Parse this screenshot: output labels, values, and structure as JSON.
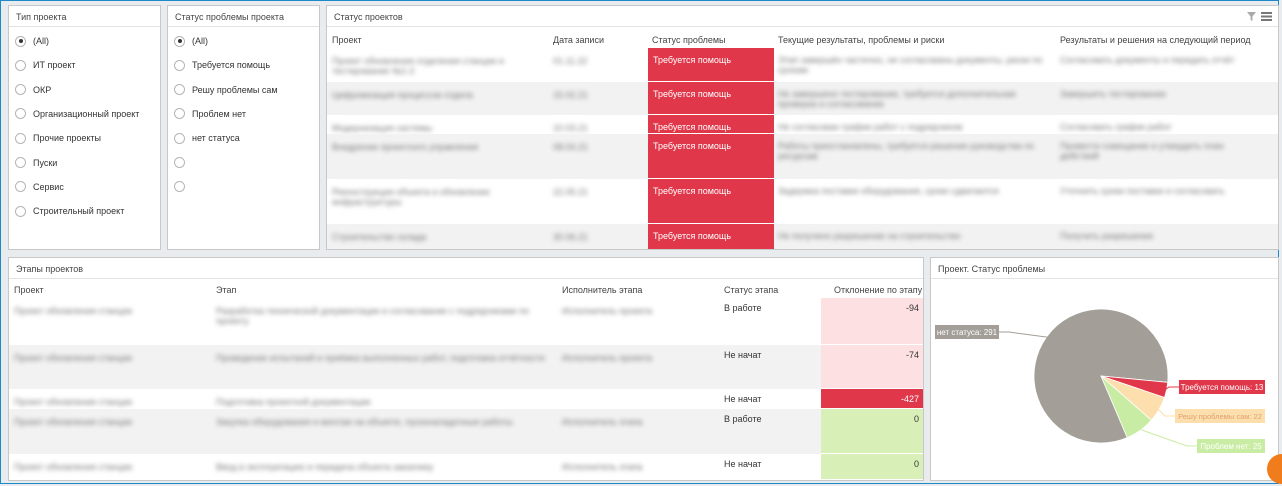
{
  "filter_project_type": {
    "title": "Тип проекта",
    "options": [
      "(All)",
      "ИТ проект",
      "ОКР",
      "Организационный проект",
      "Прочие проекты",
      "Пуски",
      "Сервис",
      "Строительный проект"
    ],
    "selected": "(All)"
  },
  "filter_problem_status": {
    "title": "Статус проблемы проекта",
    "options": [
      "(All)",
      "Требуется помощь",
      "Решу проблемы сам",
      "Проблем нет",
      "нет статуса",
      "",
      ""
    ],
    "selected": "(All)"
  },
  "project_status": {
    "title": "Статус проектов",
    "columns": [
      "Проект",
      "Дата записи",
      "Статус проблемы",
      "Текущие результаты, проблемы и риски",
      "Результаты и решения на следующий период"
    ],
    "rows": [
      {
        "project": "Проект обновления отделения станции и тестирование №1-2",
        "date": "01.11.22",
        "status": "Требуется помощь",
        "current": "Этап завершён частично, не согласованы документы, риски по срокам",
        "next": "Согласовать документы и передать отчёт"
      },
      {
        "project": "Цифровизация процессов отдела",
        "date": "15.02.21",
        "status": "Требуется помощь",
        "current": "Не завершено тестирование, требуется дополнительная проверка и согласование",
        "next": "Завершить тестирование"
      },
      {
        "project": "Модернизация системы",
        "date": "10.03.21",
        "status": "Требуется помощь",
        "current": "Не согласован график работ с подрядчиком",
        "next": "Согласовать график работ"
      },
      {
        "project": "Внедрение проектного управления",
        "date": "08.04.21",
        "status": "Требуется помощь",
        "current": "Работы приостановлены, требуется решение руководства по ресурсам",
        "next": "Провести совещание и утвердить план действий"
      },
      {
        "project": "Реконструкция объекта и обновление инфраструктуры",
        "date": "22.05.21",
        "status": "Требуется помощь",
        "current": "Задержка поставки оборудования, сроки сдвигаются",
        "next": "Уточнить сроки поставки и согласовать"
      },
      {
        "project": "Строительство склада",
        "date": "30.06.21",
        "status": "Требуется помощь",
        "current": "Не получено разрешение на строительство",
        "next": "Получить разрешение"
      }
    ]
  },
  "project_stages": {
    "title": "Этапы проектов",
    "columns": [
      "Проект",
      "Этап",
      "Исполнитель этапа",
      "Статус этапа",
      "Отклонение по этапу"
    ],
    "rows": [
      {
        "project": "Проект обновления станции",
        "stage": "Разработка технической документации и согласование с подрядчиками по проекту",
        "executor": "Исполнитель проекта",
        "status": "В работе",
        "deviation": -94,
        "color": "#fde0e2"
      },
      {
        "project": "Проект обновления станции",
        "stage": "Проведение испытаний и приёмка выполненных работ, подготовка отчётности",
        "executor": "Исполнитель проекта",
        "status": "Не начат",
        "deviation": -74,
        "color": "#fde0e2"
      },
      {
        "project": "Проект обновления станции",
        "stage": "Подготовка проектной документации",
        "executor": "",
        "status": "Не начат",
        "deviation": -427,
        "color": "#e0384a"
      },
      {
        "project": "Проект обновления станции",
        "stage": "Закупка оборудования и монтаж на объекте, пусконаладочные работы",
        "executor": "Исполнитель этапа",
        "status": "В работе",
        "deviation": 0,
        "color": "#d8f0b8"
      },
      {
        "project": "Проект обновления станции",
        "stage": "Ввод в эксплуатацию и передача объекта заказчику",
        "executor": "Исполнитель этапа",
        "status": "Не начат",
        "deviation": 0,
        "color": "#d8f0b8"
      }
    ]
  },
  "problem_chart": {
    "title": "Проект. Статус проблемы",
    "chart_data": {
      "type": "pie",
      "title": "Проект. Статус проблемы",
      "slices": [
        {
          "label": "нет статуса",
          "value": 291,
          "color": "#a39e98",
          "text": "нет статуса: 291"
        },
        {
          "label": "Требуется помощь",
          "value": 13,
          "color": "#e0384a",
          "text": "Требуется помощь: 13"
        },
        {
          "label": "Решу проблемы сам",
          "value": 22,
          "color": "#fddfae",
          "text": "Решу проблемы сам: 22"
        },
        {
          "label": "Проблем нет",
          "value": 25,
          "color": "#c9eca4",
          "text": "Проблем нет: 25"
        }
      ]
    }
  }
}
